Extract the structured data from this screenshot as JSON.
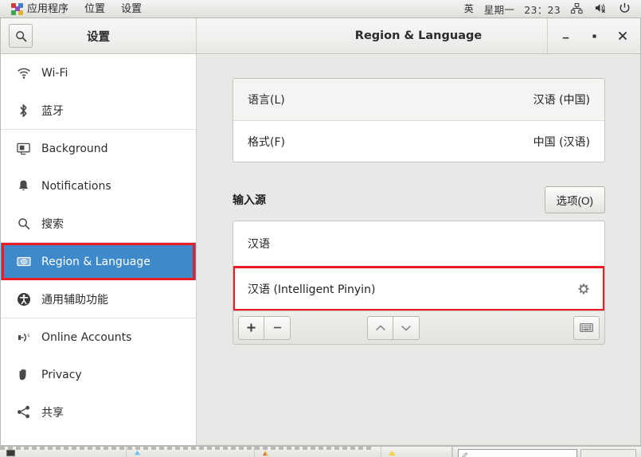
{
  "top_panel": {
    "apps_icon": "pinwheel-icon",
    "menus": [
      {
        "label": "应用程序",
        "name": "menu-applications"
      },
      {
        "label": "位置",
        "name": "menu-places"
      },
      {
        "label": "设置",
        "name": "menu-system"
      }
    ],
    "input_indicator": "英",
    "day": "星期一",
    "clock": "23：23",
    "tray": [
      {
        "name": "network-icon",
        "label": "network"
      },
      {
        "name": "volume-muted-icon",
        "label": "volume"
      },
      {
        "name": "power-icon",
        "label": "power"
      }
    ]
  },
  "window": {
    "left_title": "设置",
    "right_title": "Region & Language",
    "search_icon": "search-icon",
    "controls": {
      "minimize": "—",
      "maximize": "▫",
      "close": "✕"
    }
  },
  "sidebar": {
    "groups": [
      {
        "items": [
          {
            "label": "Wi-Fi",
            "icon": "wifi-icon",
            "selected": false
          },
          {
            "label": "蓝牙",
            "icon": "bluetooth-icon",
            "selected": false
          }
        ]
      },
      {
        "items": [
          {
            "label": "Background",
            "icon": "background-icon",
            "selected": false
          },
          {
            "label": "Notifications",
            "icon": "bell-icon",
            "selected": false
          },
          {
            "label": "搜索",
            "icon": "search-icon",
            "selected": false
          }
        ]
      },
      {
        "items": [
          {
            "label": "Region & Language",
            "icon": "flag-icon",
            "selected": true
          },
          {
            "label": "通用辅助功能",
            "icon": "accessibility-icon",
            "selected": false
          }
        ]
      },
      {
        "items": [
          {
            "label": "Online Accounts",
            "icon": "online-accounts-icon",
            "selected": false
          },
          {
            "label": "Privacy",
            "icon": "hand-icon",
            "selected": false
          },
          {
            "label": "共享",
            "icon": "share-icon",
            "selected": false
          }
        ]
      }
    ]
  },
  "main": {
    "locale_rows": [
      {
        "label": "语言(L)",
        "value": "汉语 (中国)"
      },
      {
        "label": "格式(F)",
        "value": "中国 (汉语)"
      }
    ],
    "input_sources": {
      "title": "输入源",
      "options_button": "选项(O)",
      "items": [
        {
          "label": "汉语",
          "has_gear": false,
          "highlighted": false
        },
        {
          "label": "汉语 (Intelligent Pinyin)",
          "has_gear": true,
          "highlighted": true
        }
      ],
      "toolbar": {
        "add": "+",
        "remove": "−",
        "move_up": "move-up-icon",
        "move_down": "move-down-icon",
        "keyboard": "keyboard-icon"
      }
    }
  },
  "colors": {
    "selection_blue": "#3d89c9",
    "highlight_red": "#ed1c24",
    "panel_bg": "#e8e8e6"
  }
}
